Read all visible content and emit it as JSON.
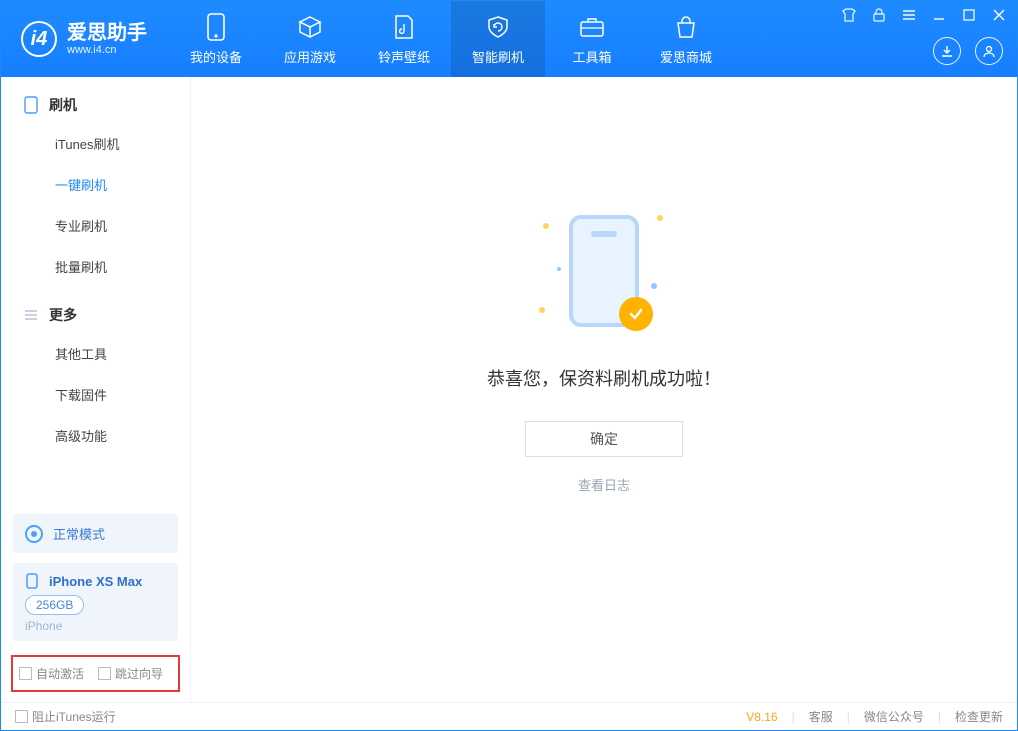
{
  "app": {
    "name_cn": "爱思助手",
    "url": "www.i4.cn"
  },
  "nav": {
    "my_device": "我的设备",
    "apps_games": "应用游戏",
    "rings_wall": "铃声壁纸",
    "smart_flash": "智能刷机",
    "toolbox": "工具箱",
    "store": "爱思商城"
  },
  "sidebar": {
    "group_flash": "刷机",
    "itunes_flash": "iTunes刷机",
    "oneclick_flash": "一键刷机",
    "pro_flash": "专业刷机",
    "batch_flash": "批量刷机",
    "group_more": "更多",
    "other_tools": "其他工具",
    "download_fw": "下载固件",
    "advanced": "高级功能"
  },
  "mode_card": {
    "label": "正常模式"
  },
  "device_card": {
    "name": "iPhone XS Max",
    "storage": "256GB",
    "type": "iPhone"
  },
  "options": {
    "auto_activate": "自动激活",
    "skip_guide": "跳过向导"
  },
  "main": {
    "success_text": "恭喜您，保资料刷机成功啦！",
    "ok_btn": "确定",
    "view_log": "查看日志"
  },
  "footer": {
    "block_itunes": "阻止iTunes运行",
    "version": "V8.16",
    "support": "客服",
    "wechat": "微信公众号",
    "check_update": "检查更新"
  }
}
